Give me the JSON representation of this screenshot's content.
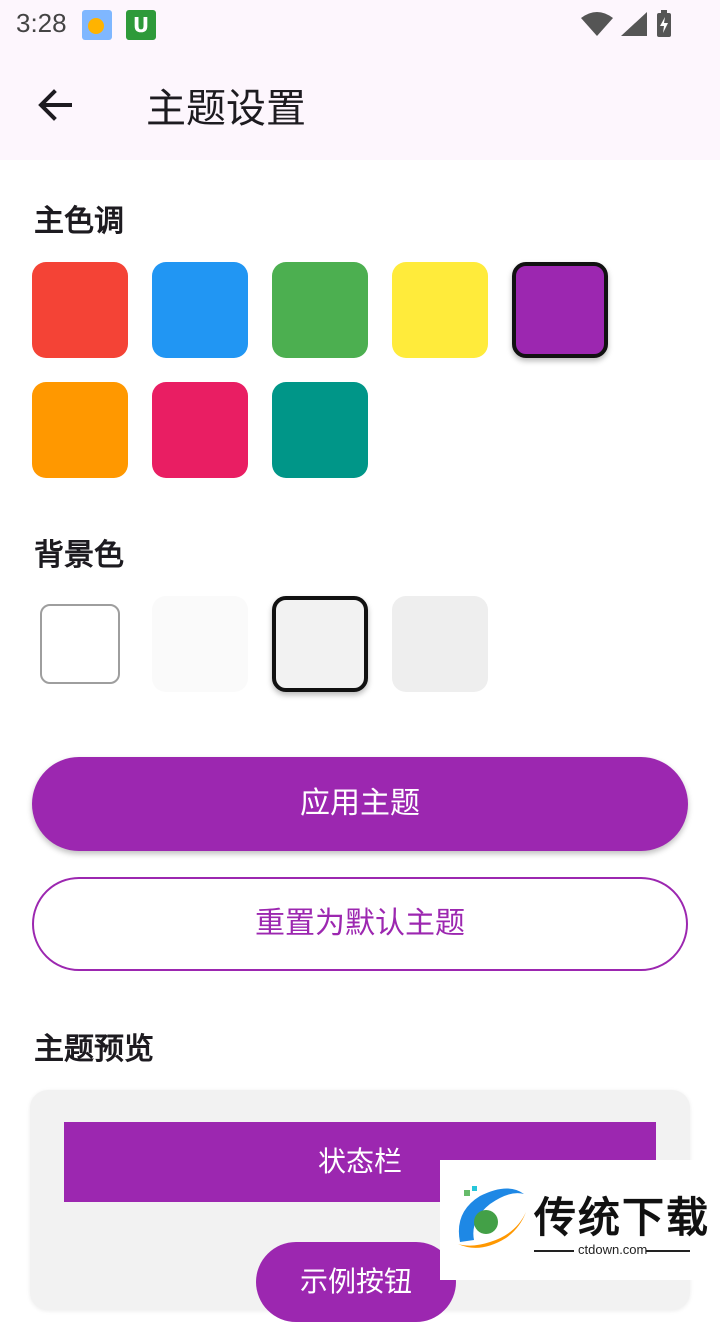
{
  "status_bar": {
    "time": "3:28",
    "notification_icons": [
      "weather-icon",
      "app-u-icon"
    ],
    "system_icons": [
      "wifi-icon",
      "cell-signal-icon",
      "battery-charging-icon"
    ]
  },
  "app_bar": {
    "back_icon": "arrow-left-icon",
    "title": "主题设置"
  },
  "primary_color": {
    "title": "主色调",
    "swatches": [
      {
        "color": "#f44336",
        "selected": false
      },
      {
        "color": "#2196f3",
        "selected": false
      },
      {
        "color": "#4caf50",
        "selected": false
      },
      {
        "color": "#ffeb3b",
        "selected": false
      },
      {
        "color": "#9c27b0",
        "selected": true
      },
      {
        "color": "#ff9800",
        "selected": false
      },
      {
        "color": "#e91e63",
        "selected": false
      },
      {
        "color": "#009688",
        "selected": false
      }
    ]
  },
  "background_color": {
    "title": "背景色",
    "swatches": [
      {
        "color": "#ffffff",
        "selected": false
      },
      {
        "color": "#fafafa",
        "selected": false
      },
      {
        "color": "#f2f2f2",
        "selected": true
      },
      {
        "color": "#eeeeee",
        "selected": false
      }
    ]
  },
  "actions": {
    "apply_label": "应用主题",
    "reset_label": "重置为默认主题"
  },
  "preview": {
    "title": "主题预览",
    "statusbar_label": "状态栏",
    "button_label": "示例按钮"
  },
  "watermark": {
    "text": "传统下载",
    "domain": "ctdown.com"
  },
  "colors": {
    "accent": "#9c27b0",
    "app_bar_bg": "#fdf6fd"
  }
}
